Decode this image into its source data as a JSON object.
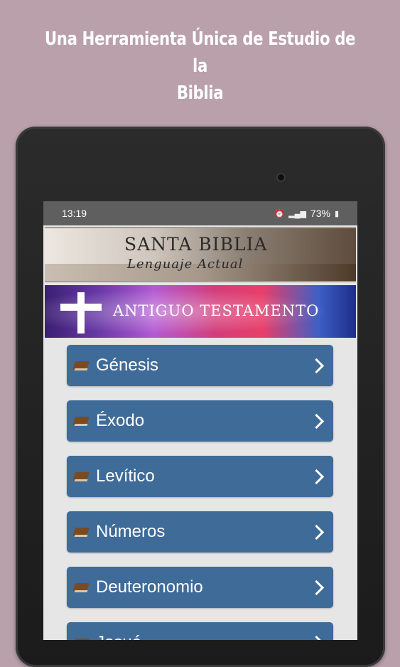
{
  "promo": {
    "line1": "Una Herramienta Única de Estudio de la",
    "line2": "Biblia"
  },
  "status_bar": {
    "time": "13:19",
    "battery": "73%"
  },
  "header": {
    "title": "SANTA BIBLIA",
    "subtitle": "Lenguaje Actual"
  },
  "section": {
    "title": "ANTIGUO TESTAMENTO"
  },
  "books": [
    {
      "label": "Génesis"
    },
    {
      "label": "Éxodo"
    },
    {
      "label": "Levítico"
    },
    {
      "label": "Números"
    },
    {
      "label": "Deuteronomio"
    },
    {
      "label": "Josué"
    }
  ],
  "colors": {
    "background": "#b9a0ab",
    "button": "#3f6b99",
    "screen": "#e6e6e6"
  }
}
